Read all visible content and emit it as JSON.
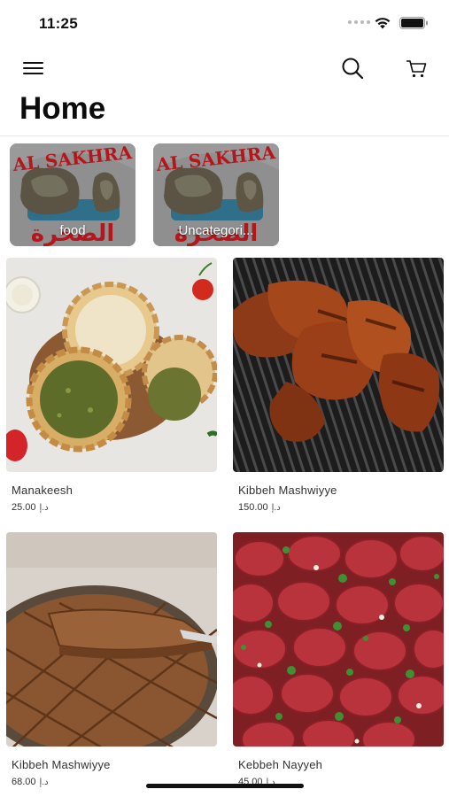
{
  "status_bar": {
    "time": "11:25"
  },
  "page": {
    "title": "Home"
  },
  "categories": [
    {
      "label": "food",
      "logo_text": "AL SAKHRA",
      "logo_text_ar": "الصخرة"
    },
    {
      "label": "Uncategori...",
      "logo_text": "AL SAKHRA",
      "logo_text_ar": "الصخرة"
    }
  ],
  "products": [
    {
      "name": "Manakeesh",
      "price": "25.00",
      "currency": "د.إ"
    },
    {
      "name": "Kibbeh Mashwiyye",
      "price": "150.00",
      "currency": "د.إ"
    },
    {
      "name": "Kibbeh Mashwiyye",
      "price": "68.00",
      "currency": "د.إ"
    },
    {
      "name": "Kebbeh Nayyeh",
      "price": "45.00",
      "currency": "د.إ"
    }
  ],
  "colors": {
    "logo_red": "#b5161c",
    "background": "#ffffff",
    "text": "#111111"
  },
  "icons": [
    "menu-icon",
    "search-icon",
    "cart-icon",
    "wifi-icon",
    "battery-icon"
  ]
}
